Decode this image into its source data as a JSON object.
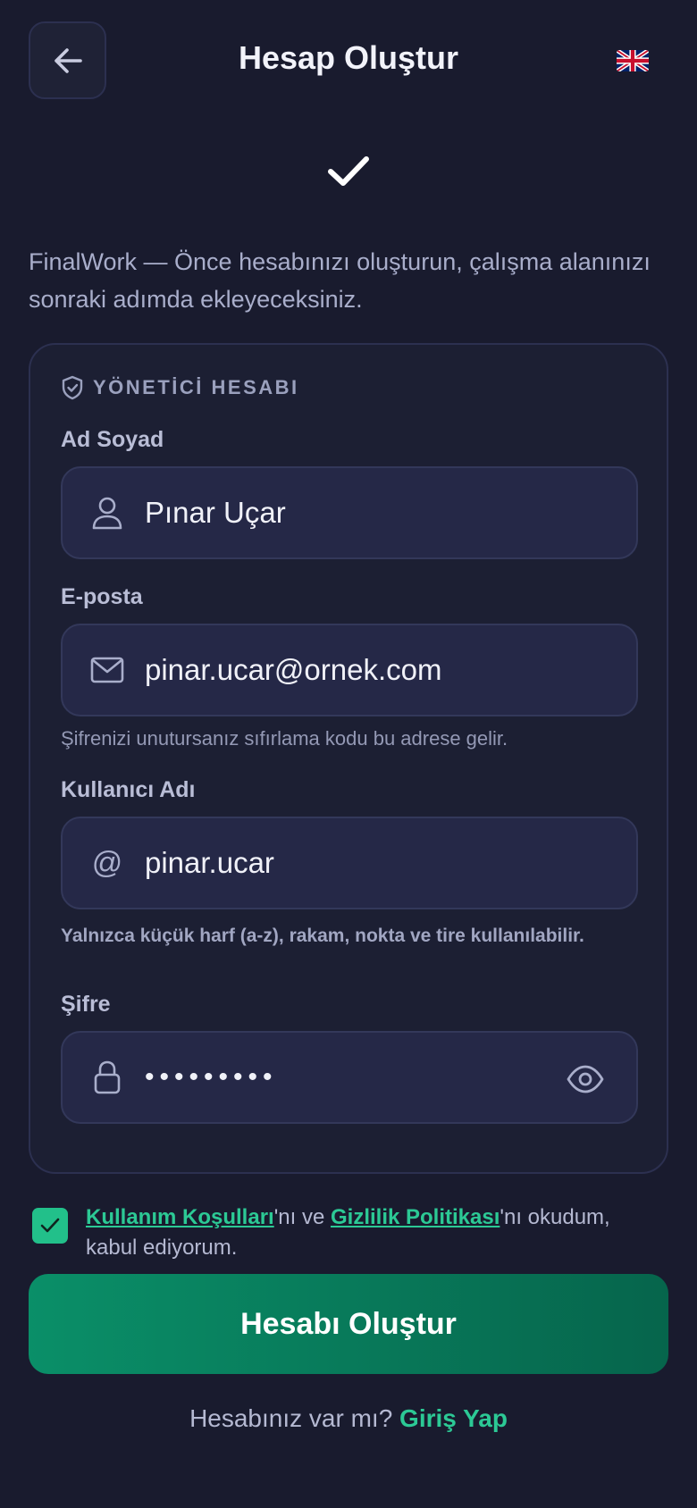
{
  "header": {
    "title": "Hesap Oluştur",
    "back_icon": "arrow-left-icon",
    "language_icon": "uk-flag-icon"
  },
  "intro": "FinalWork — Önce hesabınızı oluşturun, çalışma alanınızı sonraki adımda ekleyeceksiniz.",
  "card": {
    "section_label": "YÖNETİCİ HESABI",
    "fields": {
      "fullname": {
        "label": "Ad Soyad",
        "value": "Pınar Uçar",
        "icon": "user-icon"
      },
      "email": {
        "label": "E-posta",
        "value": "pinar.ucar@ornek.com",
        "icon": "mail-icon",
        "help": "Şifrenizi unutursanız sıfırlama kodu bu adrese gelir."
      },
      "username": {
        "label": "Kullanıcı Adı",
        "value": "pinar.ucar",
        "icon": "at-icon",
        "help": "Yalnızca küçük harf (a-z), rakam, nokta ve tire kullanılabilir."
      },
      "password": {
        "label": "Şifre",
        "value": "•••••••••",
        "icon": "lock-icon"
      }
    }
  },
  "terms": {
    "checked": true,
    "link1": "Kullanım Koşulları",
    "text1": "'nı ve ",
    "link2": "Gizlilik Politikası",
    "text2": "'nı okudum, kabul ediyorum."
  },
  "submit_label": "Hesabı Oluştur",
  "login": {
    "prompt": "Hesabınız var mı?",
    "link": "Giriş Yap"
  },
  "colors": {
    "background": "#191b2e",
    "accent": "#2cc995",
    "button": "#0a8f68"
  }
}
